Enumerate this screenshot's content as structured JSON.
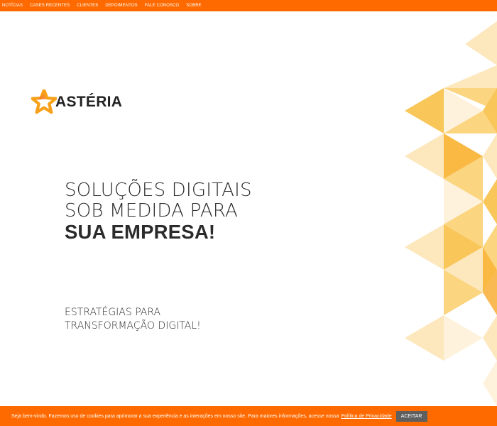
{
  "nav": {
    "items": [
      "NOTÍCIAS",
      "CASES RECENTES",
      "CLIENTES",
      "DEPOIMENTOS",
      "FALE CONOSCO",
      "SOBRE"
    ]
  },
  "brand": {
    "name": "ASTÉRIA"
  },
  "hero": {
    "line1": "SOLUÇÕES DIGITAIS",
    "line2": "SOB MEDIDA PARA",
    "line3": "SUA EMPRESA!",
    "sub1": "ESTRATÉGIAS PARA",
    "sub2": "TRANSFORMAÇÃO DIGITAL!"
  },
  "cookie": {
    "text": "Seja bem-vindo. Fazemos uso de cookies para aprimorar a sua experiência e as interações em nosso site. Para maiores informações, acesse nossa",
    "link": "Política de Privacidade",
    "button": "ACEITAR"
  },
  "colors": {
    "accent": "#ff6a00",
    "button": "#5f5f5f",
    "triangle_light": "#fde7bd",
    "triangle_mid": "#fbd57f",
    "triangle_dark": "#f9b942"
  },
  "icons": {
    "logo": "star-icon"
  }
}
